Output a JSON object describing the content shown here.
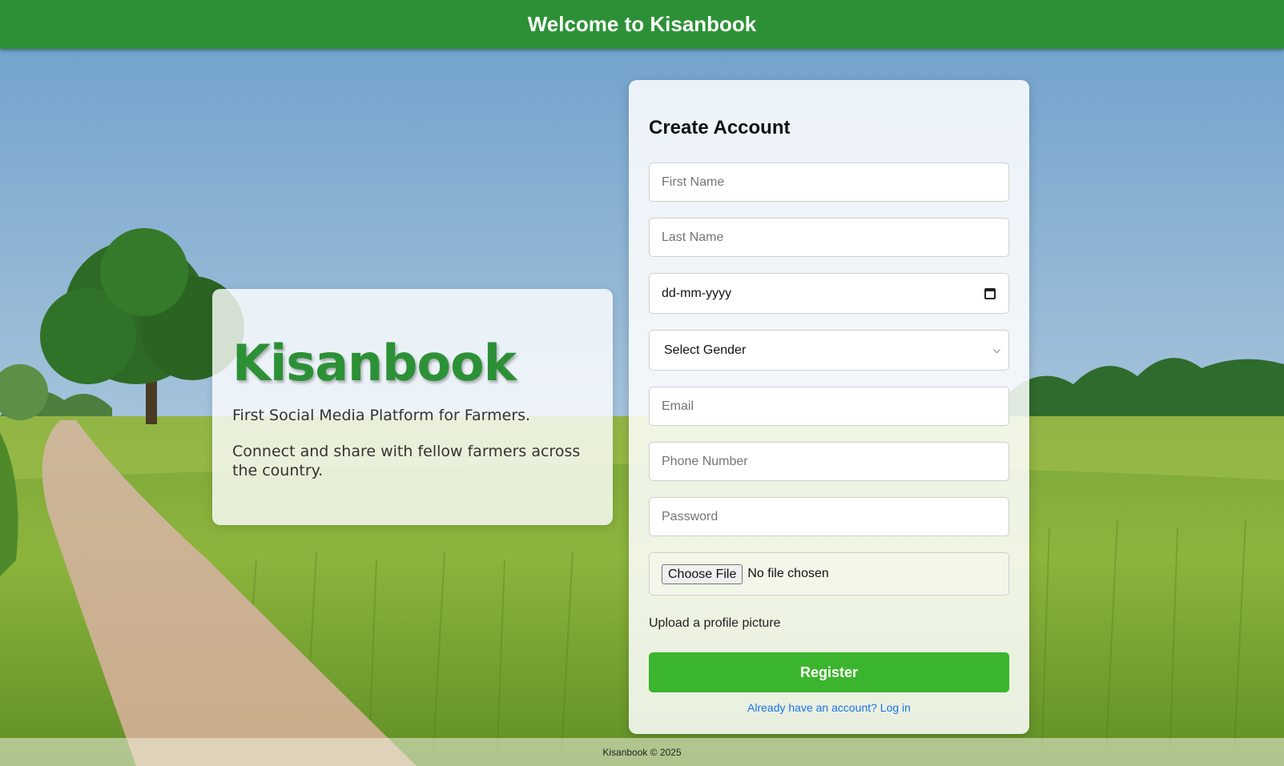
{
  "header": {
    "title": "Welcome to Kisanbook"
  },
  "hero": {
    "brand": "Kisanbook",
    "tagline": "First Social Media Platform for Farmers.",
    "description": "Connect and share with fellow farmers across the country."
  },
  "form": {
    "title": "Create Account",
    "first_name_placeholder": "First Name",
    "last_name_placeholder": "Last Name",
    "dob_placeholder": "dd-mm-yyyy",
    "gender_selected": "Select Gender",
    "email_placeholder": "Email",
    "phone_placeholder": "Phone Number",
    "password_placeholder": "Password",
    "file_button": "Choose File",
    "file_status": "No file chosen",
    "file_hint": "Upload a profile picture",
    "submit_label": "Register",
    "login_link": "Already have an account? Log in"
  },
  "footer": {
    "text": "Kisanbook © 2025"
  },
  "colors": {
    "header": "#2c9136",
    "brand": "#2c9136",
    "button": "#3cb52e",
    "link": "#1a73e8"
  },
  "icons": {
    "date": "calendar-icon",
    "select": "chevron-down-icon"
  }
}
